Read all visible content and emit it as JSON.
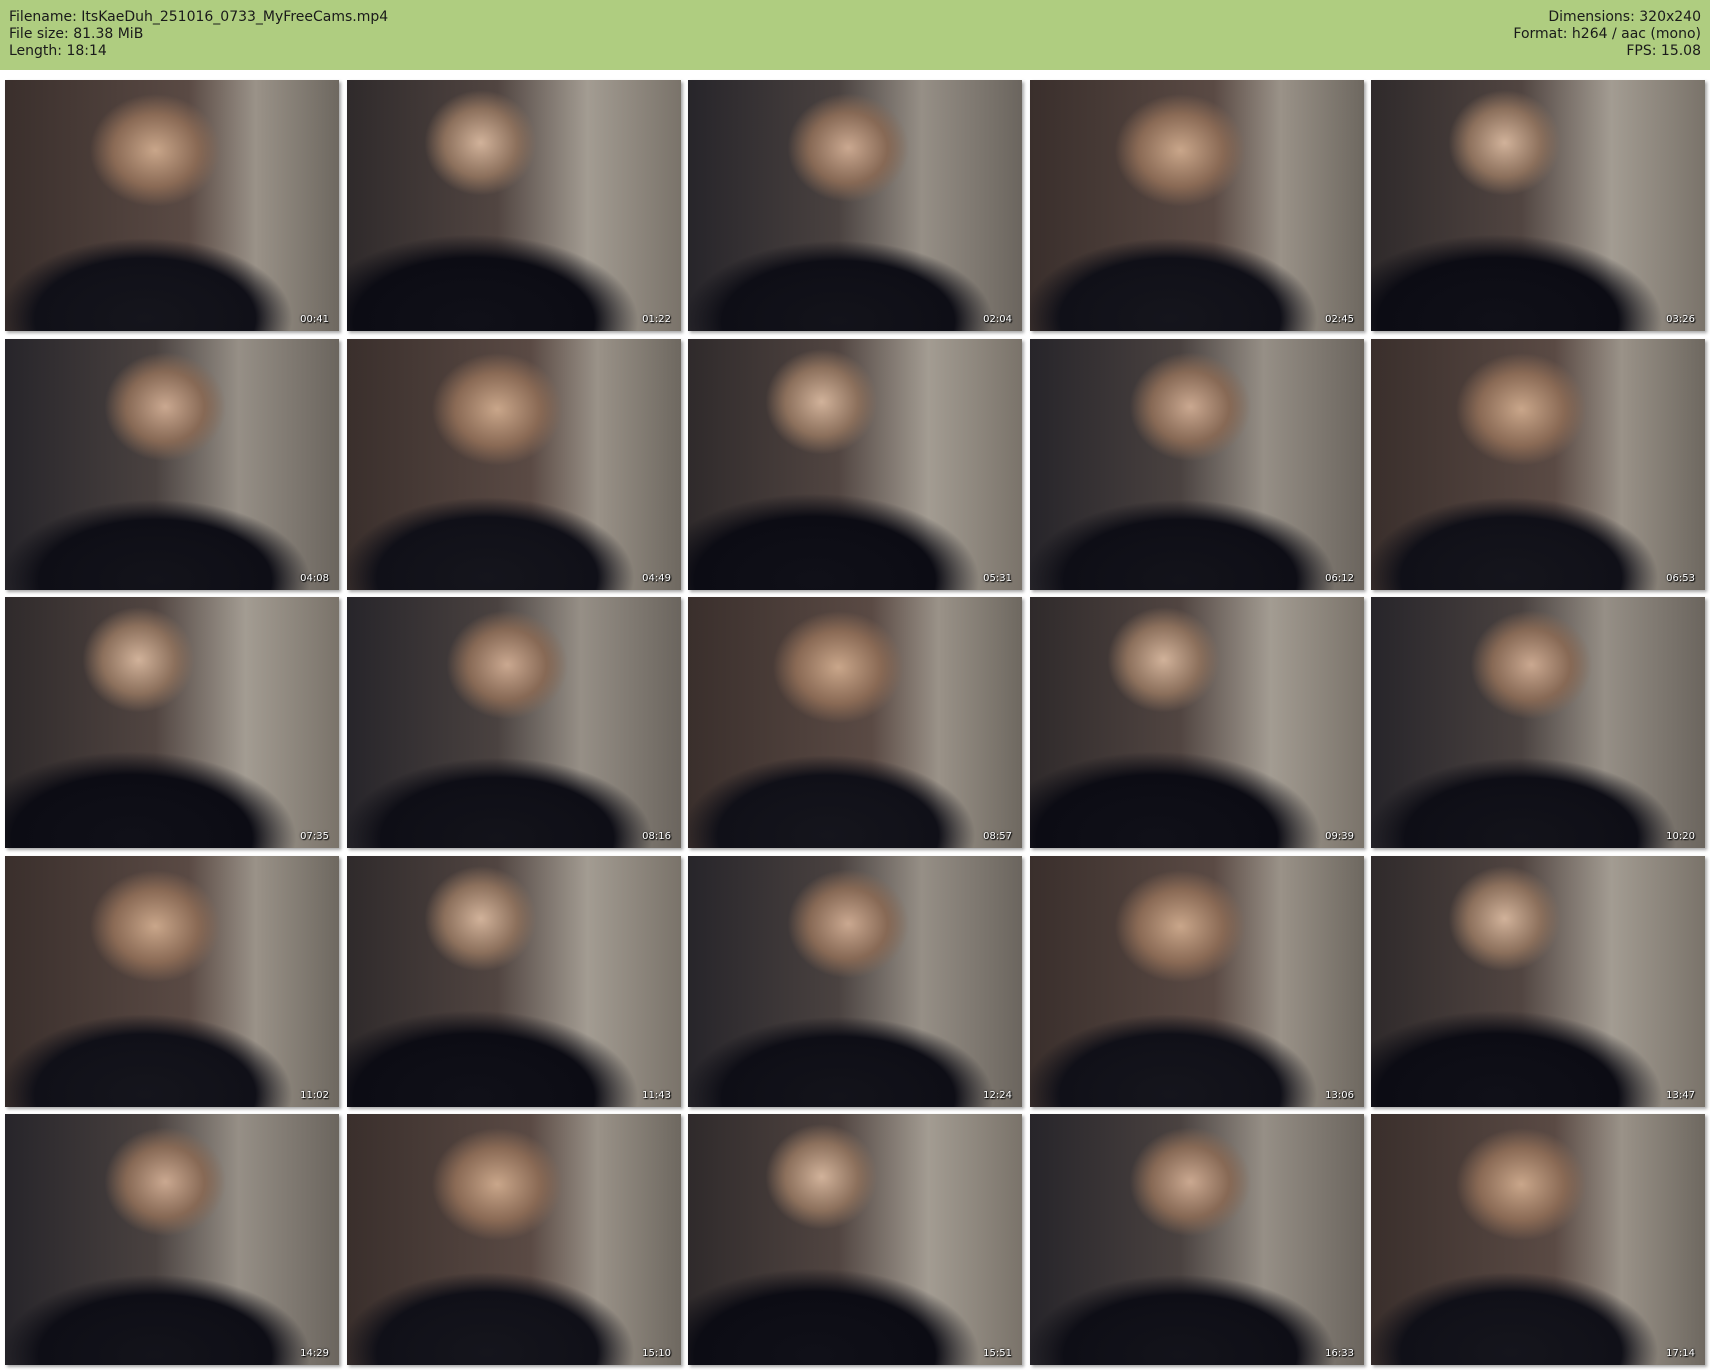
{
  "header": {
    "filename": "Filename: ItsKaeDuh_251016_0733_MyFreeCams.mp4",
    "filesize": "File size: 81.38 MiB",
    "length": "Length: 18:14",
    "dimensions": "Dimensions: 320x240",
    "format": "Format: h264 / aac (mono)",
    "fps": "FPS: 15.08"
  },
  "colors": {
    "header_bg": "#afcd80",
    "page_bg": "#ffffff"
  },
  "thumbnails": [
    {
      "time": "00:41"
    },
    {
      "time": "01:22"
    },
    {
      "time": "02:04"
    },
    {
      "time": "02:45"
    },
    {
      "time": "03:26"
    },
    {
      "time": "04:08"
    },
    {
      "time": "04:49"
    },
    {
      "time": "05:31"
    },
    {
      "time": "06:12"
    },
    {
      "time": "06:53"
    },
    {
      "time": "07:35"
    },
    {
      "time": "08:16"
    },
    {
      "time": "08:57"
    },
    {
      "time": "09:39"
    },
    {
      "time": "10:20"
    },
    {
      "time": "11:02"
    },
    {
      "time": "11:43"
    },
    {
      "time": "12:24"
    },
    {
      "time": "13:06"
    },
    {
      "time": "13:47"
    },
    {
      "time": "14:29"
    },
    {
      "time": "15:10"
    },
    {
      "time": "15:51"
    },
    {
      "time": "16:33"
    },
    {
      "time": "17:14"
    }
  ]
}
